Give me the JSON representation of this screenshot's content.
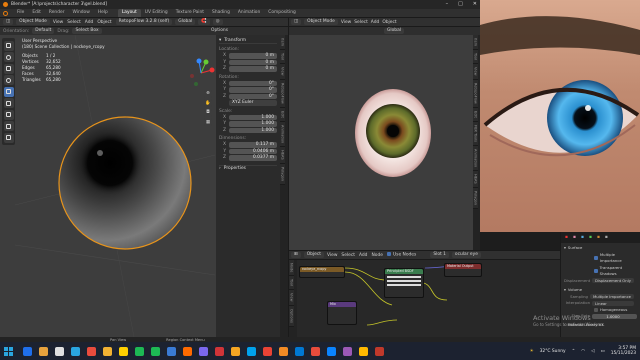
{
  "window_title": "Blender* [A:\\projects\\character 3\\gel.blend]",
  "menu": [
    "File",
    "Edit",
    "Render",
    "Window",
    "Help"
  ],
  "workspace_tabs": [
    "Layout",
    "UV Editing",
    "Texture Paint",
    "Shading",
    "Animation",
    "Compositing"
  ],
  "active_tab": "Layout",
  "viewport": {
    "mode": "Object Mode",
    "menus": [
      "View",
      "Select",
      "Add",
      "Object"
    ],
    "engine": "RetopoFlow 3.2.8 (self)",
    "orientation_label": "Orientation:",
    "orientation_value": "Default",
    "drag_label": "Drag:",
    "drag_value": "Select Box",
    "transform": "Global",
    "options": "Options",
    "overlay_title": "User Perspective",
    "overlay_sub": "(180) Scene Collection | nockeye_rcopy",
    "stats": [
      {
        "label": "Objects",
        "value": "1 / 2"
      },
      {
        "label": "Vertices",
        "value": "32,652"
      },
      {
        "label": "Edges",
        "value": "65,280"
      },
      {
        "label": "Faces",
        "value": "32,640"
      },
      {
        "label": "Triangles",
        "value": "65,280"
      }
    ]
  },
  "npanel": {
    "header": "Transform",
    "location_label": "Location:",
    "location": [
      {
        "axis": "X",
        "value": "0 m"
      },
      {
        "axis": "Y",
        "value": "0 m"
      },
      {
        "axis": "Z",
        "value": "0 m"
      }
    ],
    "rotation_label": "Rotation:",
    "rotation": [
      {
        "axis": "X",
        "value": "0°"
      },
      {
        "axis": "Y",
        "value": "0°"
      },
      {
        "axis": "Z",
        "value": "0°"
      }
    ],
    "rotation_mode": "XYZ Euler",
    "scale_label": "Scale:",
    "scale": [
      {
        "axis": "X",
        "value": "1.000"
      },
      {
        "axis": "Y",
        "value": "1.000"
      },
      {
        "axis": "Z",
        "value": "1.000"
      }
    ],
    "dimensions_label": "Dimensions:",
    "dimensions": [
      {
        "axis": "X",
        "value": "0.117 m"
      },
      {
        "axis": "Y",
        "value": "0.0406 m"
      },
      {
        "axis": "Z",
        "value": "0.0377 m"
      }
    ],
    "properties": "Properties",
    "side_tabs": [
      "Item",
      "Tool",
      "View",
      "RetopoFlow",
      "Edit",
      "Animation",
      "HEAS",
      "Polygon"
    ]
  },
  "viewport2": {
    "mode": "Object Mode",
    "menus": [
      "View",
      "Select",
      "Add",
      "Object"
    ],
    "transform": "Global",
    "side_tabs": [
      "Item",
      "Tool",
      "View",
      "RetopoFlow",
      "Edit",
      "FBX Tools",
      "Animation",
      "HEAS",
      "Polygon"
    ]
  },
  "node_editor": {
    "mode": "Object",
    "menus": [
      "View",
      "Select",
      "Add",
      "Node"
    ],
    "use_nodes": "Use Nodes",
    "slot": "Slot 1",
    "material": "ocular eye",
    "nodes": {
      "image": "rockeye_rcopy",
      "mix": "Mix",
      "bsdf": "Principled BSDF",
      "output": "Material Output"
    },
    "side_tabs": [
      "Node",
      "Tool",
      "View",
      "Options"
    ]
  },
  "properties_panel": {
    "surface": "Surface",
    "multiple_importance": "Multiple Importance",
    "transparent_shadows": "Transparent Shadows",
    "displacement_label": "Displacement",
    "displacement_value": "Displacement Only",
    "volume": "Volume",
    "sampling_label": "Sampling",
    "sampling_value": "Multiple Importance",
    "interpolation_label": "Interpolation",
    "interpolation_value": "Linear",
    "homogeneous": "Homogeneous",
    "step_rate_label": "Step Rate",
    "step_rate_value": "1.0000",
    "library": "Material Library VX"
  },
  "status_bar": {
    "left": "Pan View",
    "middle": "Region Context Menu"
  },
  "watermark": {
    "title": "Activate Windows",
    "sub": "Go to Settings to activate Windows."
  },
  "taskbar": {
    "weather": "32°C  Sunny",
    "time": "3:57 PM",
    "date": "15/11/2023",
    "icon_colors": [
      "#1f6feb",
      "#e8a33d",
      "#e0e0e0",
      "#2aa6e0",
      "#e94c3d",
      "#f1b233",
      "#ffd000",
      "#1db954",
      "#1db954",
      "#3a7bd5",
      "#ff6a00",
      "#7b68ee",
      "#d13438",
      "#f5a623",
      "#00a2ed",
      "#ea4335",
      "#f28b25",
      "#0078d4",
      "#e74c3c",
      "#0a84ff",
      "#9b59b6",
      "#ffb900",
      "#c0392b"
    ]
  }
}
